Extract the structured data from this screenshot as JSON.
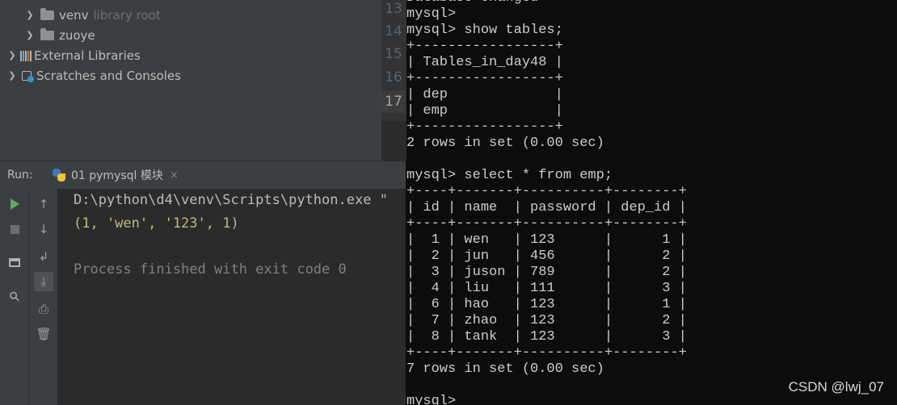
{
  "project_tree": {
    "items": [
      {
        "label": "venv",
        "hint": "library root"
      },
      {
        "label": "zuoye",
        "hint": ""
      },
      {
        "label": "External Libraries"
      },
      {
        "label": "Scratches and Consoles"
      }
    ]
  },
  "gutter": {
    "lines": [
      "13",
      "14",
      "15",
      "16",
      "17"
    ],
    "current_line": "17"
  },
  "run_panel": {
    "label": "Run:",
    "tab_title": "01 pymysql 模块",
    "tab_close": "×",
    "console": {
      "interpreter": "D:\\python\\d4\\venv\\Scripts\\python.exe \"",
      "output": "(1, 'wen', '123', 1)",
      "exit_message": "Process finished with exit code 0"
    }
  },
  "terminal": {
    "lines": [
      "Database changed",
      "mysql>",
      "mysql> show tables;",
      "+-----------------+",
      "| Tables_in_day48 |",
      "+-----------------+",
      "| dep             |",
      "| emp             |",
      "+-----------------+",
      "2 rows in set (0.00 sec)",
      "",
      "mysql> select * from emp;",
      "+----+-------+----------+--------+",
      "| id | name  | password | dep_id |",
      "+----+-------+----------+--------+",
      "|  1 | wen   | 123      |      1 |",
      "|  2 | jun   | 456      |      2 |",
      "|  3 | juson | 789      |      2 |",
      "|  4 | liu   | 111      |      3 |",
      "|  6 | hao   | 123      |      1 |",
      "|  7 | zhao  | 123      |      2 |",
      "|  8 | tank  | 123      |      3 |",
      "+----+-------+----------+--------+",
      "7 rows in set (0.00 sec)",
      "",
      "mysql>"
    ]
  },
  "watermark": "CSDN @lwj_07"
}
